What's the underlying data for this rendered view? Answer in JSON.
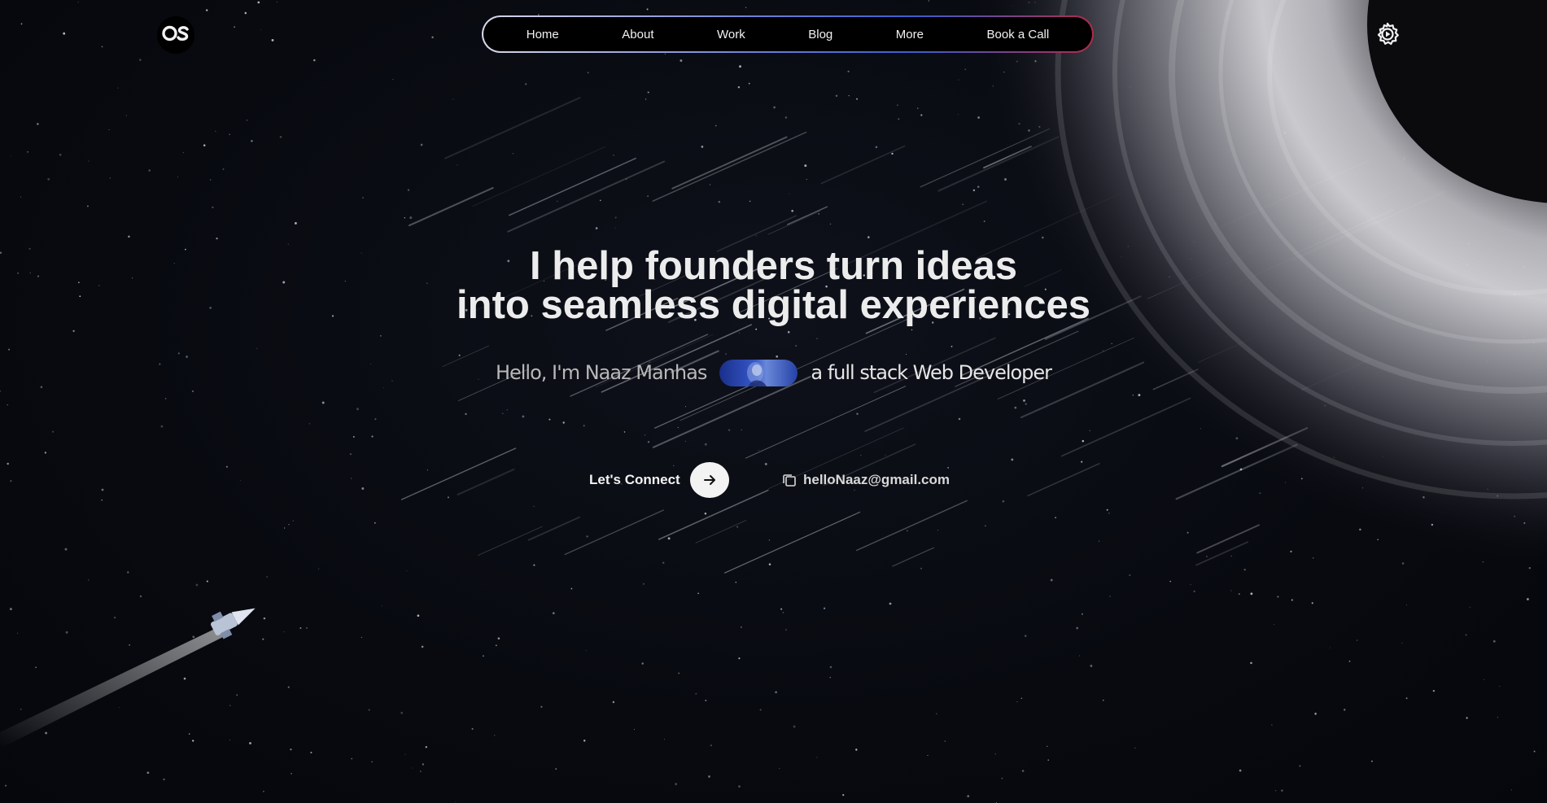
{
  "brand": {
    "logo_text": "OS"
  },
  "nav": {
    "items": [
      {
        "label": "Home"
      },
      {
        "label": "About"
      },
      {
        "label": "Work"
      },
      {
        "label": "Blog"
      },
      {
        "label": "More"
      },
      {
        "label": "Book a Call"
      }
    ]
  },
  "hero": {
    "title_line1": "I help founders turn ideas",
    "title_line2": "into seamless digital experiences",
    "intro_prefix": "Hello, I'm Naaz Manhas",
    "intro_suffix": "a full stack Web Developer",
    "cta_label": "Let's Connect",
    "email": "helloNaaz@gmail.com"
  },
  "icons": {
    "logo": "logo-icon",
    "settings": "gear-icon",
    "cta": "arrow-right-icon",
    "copy": "copy-icon"
  },
  "colors": {
    "background": "#07090f",
    "text": "#ececec",
    "nav_border_start": "#d8d8e8",
    "nav_border_mid": "#3b5fd0",
    "nav_border_end": "#b02a4a"
  }
}
